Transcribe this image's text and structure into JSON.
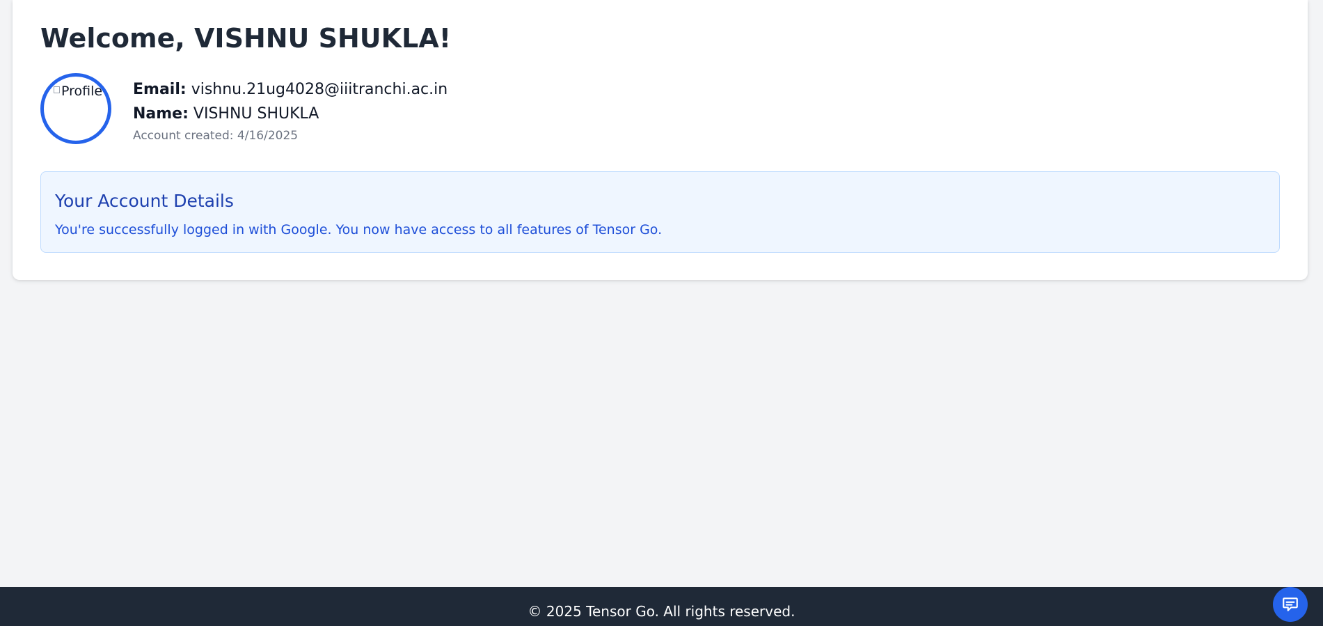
{
  "header": {
    "title": "Welcome, VISHNU SHUKLA!"
  },
  "profile": {
    "avatar_alt": "Profile",
    "email_label": "Email:",
    "email_value": "vishnu.21ug4028@iiitranchi.ac.in",
    "name_label": "Name:",
    "name_value": "VISHNU SHUKLA",
    "account_created": "Account created: 4/16/2025"
  },
  "details": {
    "title": "Your Account Details",
    "text": "You're successfully logged in with Google. You now have access to all features of Tensor Go."
  },
  "footer": {
    "text": "© 2025 Tensor Go. All rights reserved."
  },
  "chat": {
    "icon": "chat-icon"
  },
  "colors": {
    "accent": "#2563eb",
    "background": "#f3f4f6",
    "footer": "#1f2937",
    "info_box": "#eff6ff",
    "info_text": "#1d4ed8"
  }
}
